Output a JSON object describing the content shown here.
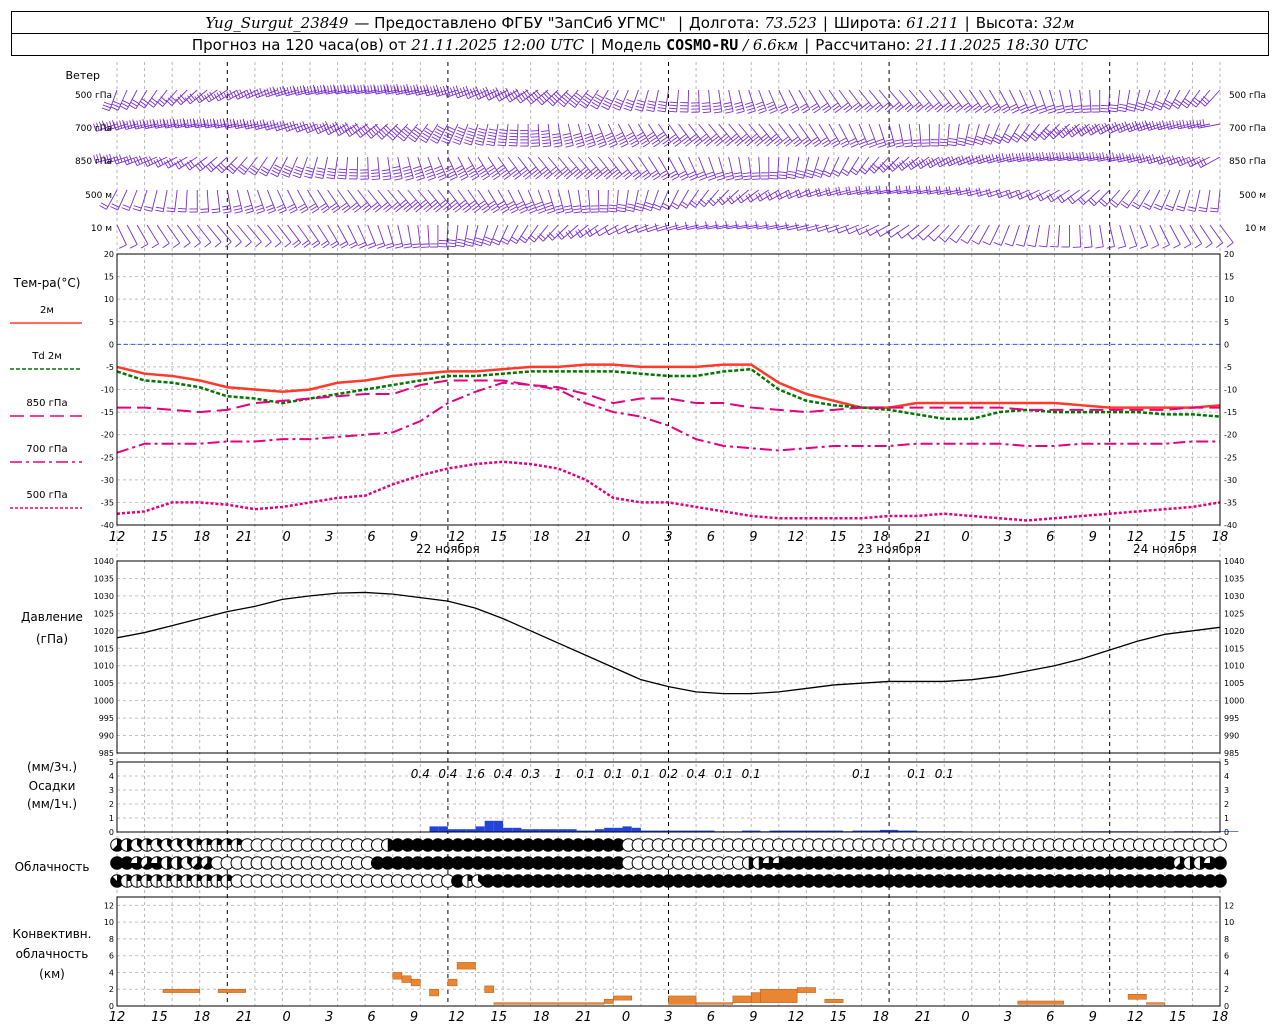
{
  "header": {
    "station": "Yug_Surgut_23849",
    "provided": "— Предоставлено ФГБУ \"ЗапСиб УГМС\"",
    "lon_label": "Долгота:",
    "lon_value": "73.523",
    "lat_label": "Широта:",
    "lat_value": "61.211",
    "alt_label": "Высота:",
    "alt_value": "32м",
    "forecast_prefix": "Прогноз на 120 часа(ов) от",
    "forecast_from": "21.11.2025 12:00 UTC",
    "model_label": "Модель",
    "model_name": "COSMO-RU",
    "model_res": "/ 6.6км",
    "calc_label": "Рассчитано:",
    "calc_value": "21.11.2025 18:30 UTC"
  },
  "panels": {
    "wind": {
      "title": "Ветер",
      "levels": [
        "500 гПа",
        "700 гПа",
        "850 гПа",
        "500 м",
        "10  м"
      ]
    },
    "temperature": {
      "title": "Тем-ра(°С)"
    },
    "pressure": {
      "title1": "Давление",
      "title2": "(гПа)"
    },
    "precip": {
      "title1": "(мм/3ч.)",
      "title2": "Осадки",
      "title3": "(мм/1ч.)"
    },
    "cloud": {
      "title": "Облачность"
    },
    "convective": {
      "title1": "Конвективн.",
      "title2": "облачность",
      "title3": "(км)"
    }
  },
  "colors": {
    "wind": "#7a2fd0",
    "t2m": "#ff3a2a",
    "td2m": "#007700",
    "t850": "#e4007f",
    "t700": "#e4007f",
    "t500": "#e4007f",
    "zero": "#3355ff",
    "precip": "#2244dd",
    "conv": "#ea8633"
  },
  "chart_data": [
    {
      "type": "line",
      "name": "temperature",
      "x_hours": [
        0,
        3,
        6,
        9,
        12,
        15,
        18,
        21,
        24,
        27,
        30,
        33,
        36,
        39,
        42,
        45,
        48,
        51,
        54,
        57,
        60,
        63,
        66,
        69,
        72,
        75,
        78,
        81,
        84,
        87,
        90,
        93,
        96,
        99,
        102,
        105,
        108,
        111,
        114,
        117,
        120
      ],
      "x_tick_labels": [
        "12",
        "15",
        "18",
        "21",
        "0",
        "3",
        "6",
        "9",
        "12",
        "15",
        "18",
        "21",
        "0",
        "3",
        "6",
        "9",
        "12",
        "15",
        "18",
        "21",
        "0",
        "3",
        "6",
        "9",
        "12",
        "15",
        "18"
      ],
      "day_labels": [
        "22 ноября",
        "23 ноября",
        "24 ноября"
      ],
      "ylim": [
        -40,
        20
      ],
      "yticks": [
        20,
        15,
        10,
        5,
        0,
        -5,
        -10,
        -15,
        -20,
        -25,
        -30,
        -35,
        -40
      ],
      "series": [
        {
          "name": "2м",
          "values": [
            -5,
            -6.5,
            -7,
            -8,
            -9.5,
            -10,
            -10.5,
            -10,
            -8.5,
            -8,
            -7,
            -6.5,
            -6,
            -6,
            -5.5,
            -5,
            -5,
            -4.5,
            -4.5,
            -5,
            -5,
            -5,
            -4.5,
            -4.5,
            -8.5,
            -11,
            -12.5,
            -14,
            -14,
            -13,
            -13,
            -13,
            -13,
            -13,
            -13,
            -13.5,
            -14,
            -14,
            -14,
            -14,
            -13.5
          ]
        },
        {
          "name": "Td  2м",
          "values": [
            -6,
            -8,
            -8.5,
            -9.5,
            -11.5,
            -12,
            -13,
            -12,
            -11,
            -10,
            -9,
            -8,
            -7,
            -7,
            -6.5,
            -6,
            -6,
            -6,
            -6,
            -6.5,
            -7,
            -7,
            -6,
            -5.5,
            -10,
            -12.5,
            -13.5,
            -14,
            -14.5,
            -15.5,
            -16.5,
            -16.5,
            -15,
            -14.5,
            -15,
            -15,
            -15,
            -15,
            -15.5,
            -15.5,
            -16
          ]
        },
        {
          "name": "850 гПа",
          "values": [
            -14,
            -14,
            -14.5,
            -15,
            -14.5,
            -13,
            -12.5,
            -12,
            -11.5,
            -11,
            -11,
            -9,
            -8,
            -8,
            -8,
            -9,
            -9.5,
            -11,
            -13,
            -12,
            -12,
            -13,
            -13,
            -14,
            -14.5,
            -15,
            -14.5,
            -14,
            -14,
            -14,
            -14,
            -14,
            -14,
            -14.5,
            -14.5,
            -14.5,
            -14.5,
            -14.5,
            -14.5,
            -14,
            -14
          ]
        },
        {
          "name": "700 гПа",
          "values": [
            -24,
            -22,
            -22,
            -22,
            -21.5,
            -21.5,
            -21,
            -21,
            -20.5,
            -20,
            -19.5,
            -17,
            -13,
            -10.5,
            -8.5,
            -9,
            -10,
            -13,
            -15,
            -16,
            -18,
            -21,
            -22.5,
            -23,
            -23.5,
            -23,
            -22.5,
            -22.5,
            -22.5,
            -22,
            -22,
            -22,
            -22,
            -22.5,
            -22.5,
            -22,
            -22,
            -22,
            -22,
            -21.5,
            -21.5
          ]
        },
        {
          "name": "500 гПа",
          "values": [
            -37.5,
            -37,
            -35,
            -35,
            -35.5,
            -36.5,
            -36,
            -35,
            -34,
            -33.5,
            -31,
            -29,
            -27.5,
            -26.5,
            -26,
            -26.5,
            -27.5,
            -30,
            -34,
            -35,
            -35,
            -36,
            -37,
            -38,
            -38.5,
            -38.5,
            -38.5,
            -38.5,
            -38,
            -38,
            -37.5,
            -38,
            -38.5,
            -39,
            -38.5,
            -38,
            -37.5,
            -37,
            -36.5,
            -36,
            -35
          ]
        }
      ]
    },
    {
      "type": "line",
      "name": "pressure",
      "x_hours": [
        0,
        3,
        6,
        9,
        12,
        15,
        18,
        21,
        24,
        27,
        30,
        33,
        36,
        39,
        42,
        45,
        48,
        51,
        54,
        57,
        60,
        63,
        66,
        69,
        72,
        75,
        78,
        81,
        84,
        87,
        90,
        93,
        96,
        99,
        102,
        105,
        108,
        111,
        114,
        117,
        120
      ],
      "ylim": [
        985,
        1040
      ],
      "yticks": [
        1040,
        1035,
        1030,
        1025,
        1020,
        1015,
        1010,
        1005,
        1000,
        995,
        990,
        985
      ],
      "series": [
        {
          "name": "Давление",
          "values": [
            1018,
            1019.5,
            1021.5,
            1023.5,
            1025.5,
            1027,
            1029,
            1030,
            1030.8,
            1031,
            1030.5,
            1029.5,
            1028.5,
            1026.5,
            1023.5,
            1020,
            1016.5,
            1013,
            1009.5,
            1006,
            1004,
            1002.5,
            1002,
            1002,
            1002.5,
            1003.5,
            1004.5,
            1005,
            1005.5,
            1005.5,
            1005.5,
            1006,
            1007,
            1008.5,
            1010,
            1012,
            1014.5,
            1017,
            1019,
            1020,
            1021,
            1022
          ]
        }
      ]
    },
    {
      "type": "bar",
      "name": "precipitation",
      "ylim": [
        0,
        5
      ],
      "yticks": [
        5,
        4,
        3,
        2,
        1,
        0
      ],
      "labels_3h": [
        {
          "hour": 33,
          "text": "0.4"
        },
        {
          "hour": 36,
          "text": "0.4"
        },
        {
          "hour": 39,
          "text": "1.6"
        },
        {
          "hour": 42,
          "text": "0.4"
        },
        {
          "hour": 45,
          "text": "0.3"
        },
        {
          "hour": 48,
          "text": "1"
        },
        {
          "hour": 51,
          "text": "0.1"
        },
        {
          "hour": 54,
          "text": "0.1"
        },
        {
          "hour": 57,
          "text": "0.1"
        },
        {
          "hour": 60,
          "text": "0.2"
        },
        {
          "hour": 63,
          "text": "0.4"
        },
        {
          "hour": 66,
          "text": "0.1"
        },
        {
          "hour": 69,
          "text": "0.1"
        },
        {
          "hour": 81,
          "text": "0.1"
        },
        {
          "hour": 87,
          "text": "0.1"
        },
        {
          "hour": 90,
          "text": "0.1"
        }
      ],
      "hourly_mm": [
        0,
        0,
        0,
        0,
        0,
        0,
        0,
        0,
        0,
        0,
        0,
        0,
        0,
        0,
        0,
        0,
        0,
        0,
        0,
        0,
        0,
        0,
        0,
        0,
        0,
        0,
        0,
        0,
        0,
        0,
        0,
        0,
        0,
        0,
        0.4,
        0.4,
        0.2,
        0.2,
        0.2,
        0.4,
        0.8,
        0.8,
        0.3,
        0.3,
        0.2,
        0.2,
        0.2,
        0.2,
        0.2,
        0.2,
        0.1,
        0.1,
        0.2,
        0.3,
        0.3,
        0.4,
        0.3,
        0.1,
        0.1,
        0.1,
        0.1,
        0.1,
        0.1,
        0.1,
        0.1,
        0.05,
        0.05,
        0.05,
        0.1,
        0.1,
        0.05,
        0.1,
        0.1,
        0.1,
        0.1,
        0.1,
        0.1,
        0.1,
        0.1,
        0.05,
        0.1,
        0.1,
        0.1,
        0.15,
        0.15,
        0.1,
        0.1,
        0.05,
        0.05,
        0.05,
        0.05,
        0.05,
        0,
        0,
        0,
        0,
        0,
        0,
        0,
        0,
        0,
        0,
        0,
        0,
        0,
        0.05,
        0.05,
        0.05,
        0.05,
        0.05,
        0.05,
        0,
        0,
        0,
        0,
        0.05,
        0.05,
        0.05,
        0,
        0.05,
        0.05,
        0.05,
        0
      ]
    },
    {
      "type": "table",
      "name": "cloudiness",
      "note": "okta symbols per hour, rows top-to-bottom",
      "rows": [
        [
          5,
          4,
          3,
          2,
          3,
          3,
          3,
          3,
          2,
          2,
          2,
          2,
          2,
          0,
          0,
          0,
          0,
          0,
          0,
          0,
          0,
          0,
          0,
          0,
          0,
          0,
          0,
          4,
          8,
          8,
          8,
          8,
          8,
          8,
          8,
          8,
          8,
          8,
          8,
          8,
          8,
          8,
          8,
          8,
          8,
          8,
          8,
          8,
          8,
          8,
          8,
          0,
          0,
          0,
          0,
          0,
          0,
          0,
          0,
          0,
          0,
          0,
          0,
          0,
          0,
          0,
          0,
          0,
          0,
          0,
          0,
          0,
          0,
          0,
          0,
          0,
          0,
          0,
          0,
          0,
          0,
          0,
          0,
          0,
          0,
          0,
          0,
          0,
          0,
          0,
          0,
          0,
          0,
          0,
          0,
          0,
          0,
          0,
          0,
          0,
          0,
          0,
          0,
          0,
          0,
          0,
          0,
          0,
          0,
          0,
          0,
          0,
          0,
          0,
          0,
          0,
          0
        ],
        [
          8,
          8,
          6,
          5,
          6,
          4,
          4,
          3,
          5,
          5,
          0,
          0,
          0,
          0,
          0,
          0,
          0,
          0,
          0,
          0,
          0,
          0,
          0,
          0,
          0,
          0,
          8,
          8,
          8,
          8,
          8,
          8,
          8,
          8,
          8,
          8,
          8,
          8,
          8,
          8,
          8,
          8,
          8,
          8,
          8,
          8,
          8,
          8,
          8,
          8,
          8,
          0,
          0,
          0,
          0,
          0,
          0,
          0,
          0,
          0,
          0,
          0,
          0,
          4,
          4,
          6,
          6,
          8,
          8,
          8,
          8,
          8,
          8,
          8,
          8,
          8,
          8,
          8,
          8,
          8,
          8,
          8,
          8,
          8,
          8,
          8,
          8,
          8,
          8,
          8,
          8,
          8,
          8,
          8,
          8,
          8,
          8,
          8,
          8,
          8,
          8,
          8,
          8,
          8,
          8,
          8,
          5,
          4,
          4,
          6,
          8,
          8,
          8,
          8,
          0,
          0,
          0,
          0,
          0,
          0,
          0
        ],
        [
          7,
          2,
          2,
          2,
          2,
          2,
          2,
          2,
          2,
          2,
          2,
          2,
          0,
          0,
          0,
          0,
          0,
          0,
          0,
          0,
          0,
          0,
          0,
          0,
          0,
          0,
          0,
          0,
          0,
          0,
          0,
          0,
          0,
          0,
          8,
          2,
          3,
          8,
          8,
          8,
          8,
          8,
          8,
          8,
          8,
          8,
          8,
          8,
          8,
          8,
          8,
          8,
          8,
          8,
          8,
          8,
          8,
          8,
          8,
          8,
          8,
          8,
          8,
          8,
          8,
          8,
          8,
          8,
          8,
          8,
          8,
          8,
          8,
          8,
          8,
          8,
          8,
          8,
          8,
          8,
          8,
          8,
          8,
          8,
          8,
          8,
          8,
          8,
          8,
          8,
          8,
          8,
          8,
          8,
          8,
          8,
          8,
          8,
          8,
          8,
          8,
          8,
          8,
          8,
          8,
          8,
          8,
          8,
          8,
          8,
          8,
          8,
          8,
          8,
          8,
          8,
          8,
          8,
          8,
          8,
          8
        ]
      ]
    },
    {
      "type": "bar",
      "name": "convective_cloud",
      "ylim": [
        0,
        13
      ],
      "yticks": [
        12,
        10,
        8,
        6,
        4,
        2,
        0
      ],
      "segments_km": [
        {
          "h0": 5,
          "h1": 9,
          "top": 2.0,
          "base": 1.6
        },
        {
          "h0": 11,
          "h1": 14,
          "top": 2.0,
          "base": 1.6
        },
        {
          "h0": 30,
          "h1": 31,
          "top": 4.0,
          "base": 3.2
        },
        {
          "h0": 31,
          "h1": 32,
          "top": 3.6,
          "base": 2.8
        },
        {
          "h0": 32,
          "h1": 33,
          "top": 3.2,
          "base": 2.4
        },
        {
          "h0": 34,
          "h1": 35,
          "top": 2.0,
          "base": 1.2
        },
        {
          "h0": 36,
          "h1": 37,
          "top": 3.2,
          "base": 2.4
        },
        {
          "h0": 37,
          "h1": 39,
          "top": 5.2,
          "base": 4.4
        },
        {
          "h0": 40,
          "h1": 41,
          "top": 2.4,
          "base": 1.6
        },
        {
          "h0": 41,
          "h1": 53,
          "top": 0.4,
          "base": 0.2
        },
        {
          "h0": 53,
          "h1": 54,
          "top": 0.8,
          "base": 0.3
        },
        {
          "h0": 54,
          "h1": 56,
          "top": 1.2,
          "base": 0.7
        },
        {
          "h0": 60,
          "h1": 63,
          "top": 1.2,
          "base": 0.2
        },
        {
          "h0": 63,
          "h1": 67,
          "top": 0.4,
          "base": 0.2
        },
        {
          "h0": 67,
          "h1": 69,
          "top": 1.2,
          "base": 0.4
        },
        {
          "h0": 69,
          "h1": 70,
          "top": 1.6,
          "base": 0.4
        },
        {
          "h0": 70,
          "h1": 74,
          "top": 2.0,
          "base": 0.4
        },
        {
          "h0": 74,
          "h1": 76,
          "top": 2.2,
          "base": 1.6
        },
        {
          "h0": 77,
          "h1": 79,
          "top": 0.8,
          "base": 0.4
        },
        {
          "h0": 98,
          "h1": 103,
          "top": 0.6,
          "base": 0.2
        },
        {
          "h0": 110,
          "h1": 112,
          "top": 1.4,
          "base": 0.8
        },
        {
          "h0": 112,
          "h1": 114,
          "top": 0.4,
          "base": 0.2
        }
      ]
    }
  ]
}
